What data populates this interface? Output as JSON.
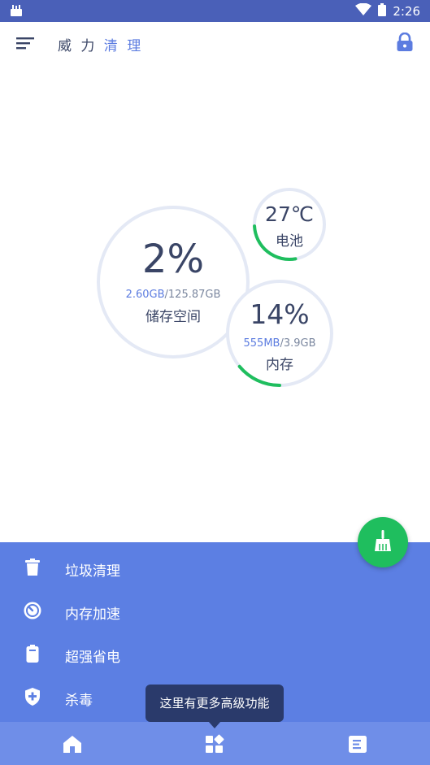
{
  "status_bar": {
    "time": "2:26"
  },
  "app_bar": {
    "title_part1": "威 力",
    "title_part2": " 清 理"
  },
  "gauges": {
    "storage": {
      "percent": "2%",
      "used": "2.60GB",
      "total": "/125.87GB",
      "label": "储存空间",
      "fraction": 0.02
    },
    "battery": {
      "temperature": "27℃",
      "label": "电池",
      "fraction": 0.27
    },
    "memory": {
      "percent": "14%",
      "used": "555MB",
      "total": "/3.9GB",
      "label": "内存",
      "fraction": 0.14
    }
  },
  "menu": {
    "items": [
      {
        "label": "垃圾清理",
        "icon": "trash-icon"
      },
      {
        "label": "内存加速",
        "icon": "speedometer-icon"
      },
      {
        "label": "超强省电",
        "icon": "battery-icon"
      },
      {
        "label": "杀毒",
        "icon": "shield-plus-icon"
      }
    ]
  },
  "tooltip": {
    "text": "这里有更多高级功能"
  },
  "colors": {
    "status_bar": "#4a60b8",
    "panel": "#5c7fe3",
    "accent_green": "#1fbe5e",
    "gauge_ring": "#e4e9f5",
    "tooltip": "#2a3a6b"
  }
}
